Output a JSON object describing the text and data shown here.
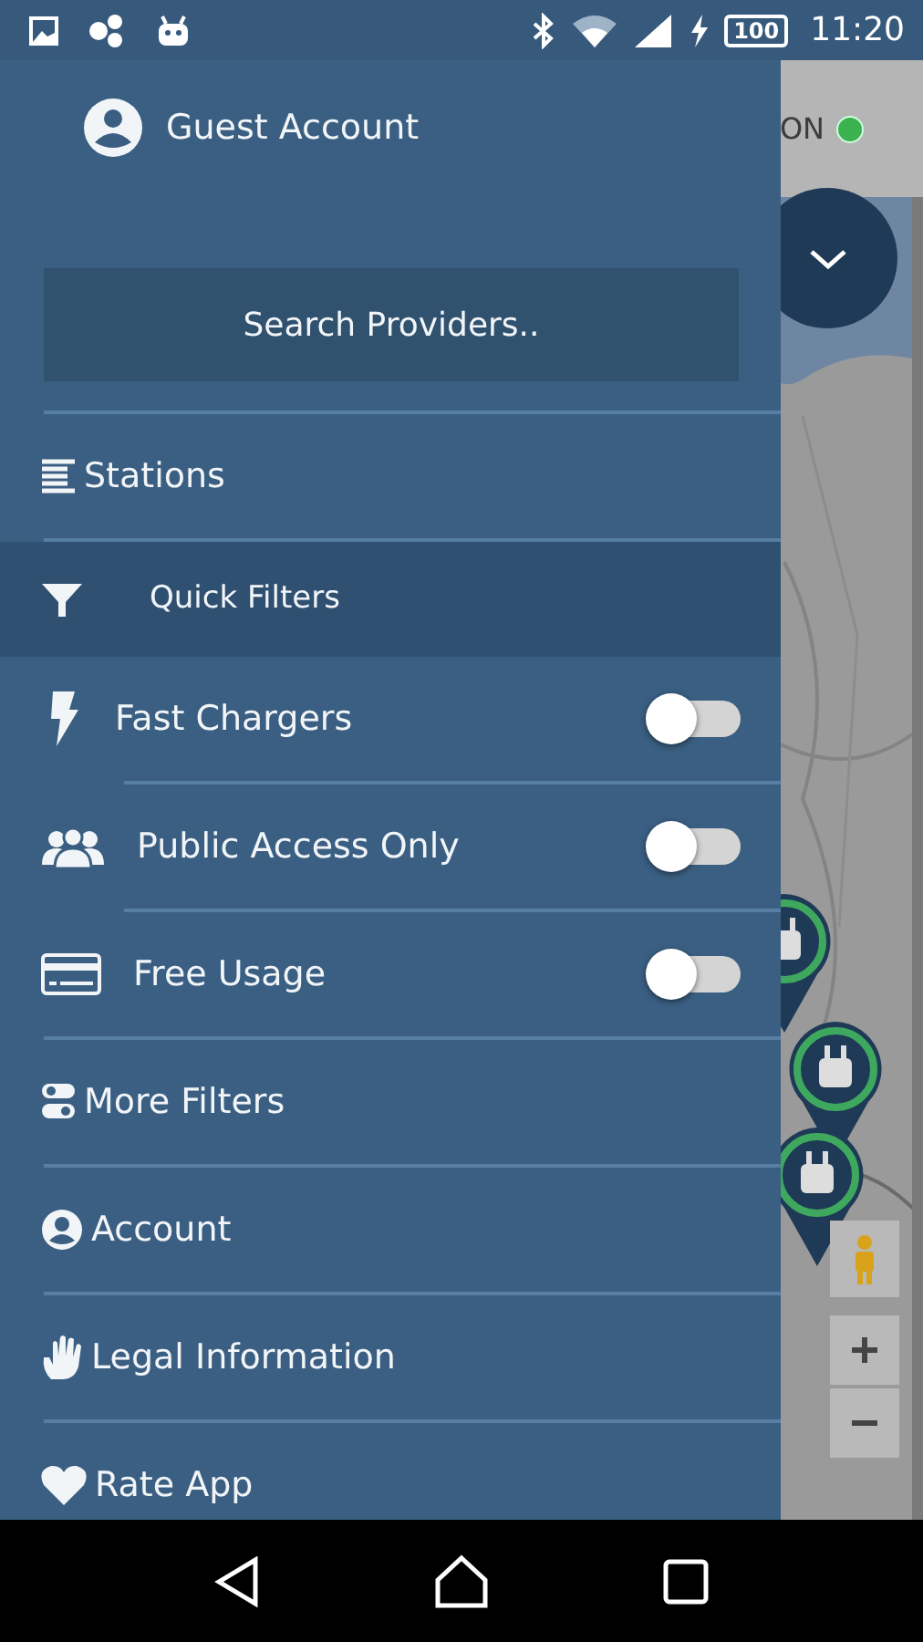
{
  "status_bar": {
    "battery": "100",
    "time": "11:20"
  },
  "map": {
    "status_label": "ON"
  },
  "drawer": {
    "account": "Guest Account",
    "search": {
      "placeholder": "Search Providers.."
    },
    "items": [
      {
        "kind": "link",
        "label": "Stations"
      },
      {
        "kind": "header",
        "label": "Quick Filters"
      },
      {
        "kind": "toggle",
        "label": "Fast Chargers",
        "on": false
      },
      {
        "kind": "toggle",
        "label": "Public Access Only",
        "on": false
      },
      {
        "kind": "toggle",
        "label": "Free Usage",
        "on": false
      },
      {
        "kind": "link",
        "label": "More Filters"
      },
      {
        "kind": "link",
        "label": "Account"
      },
      {
        "kind": "link",
        "label": "Legal Information"
      },
      {
        "kind": "link",
        "label": "Rate App"
      }
    ]
  }
}
